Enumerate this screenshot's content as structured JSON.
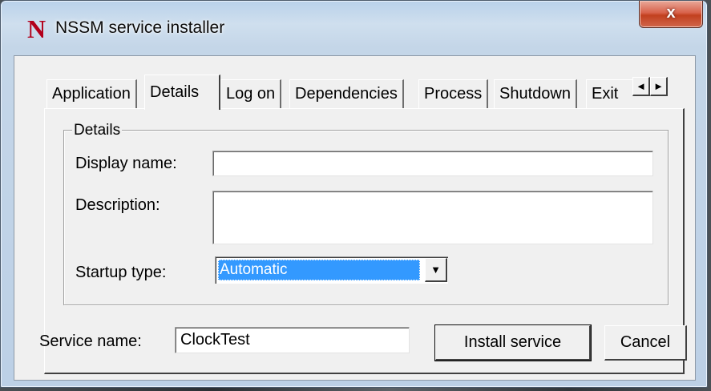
{
  "window": {
    "title": "NSSM service installer",
    "icon_letter": "N",
    "close_glyph": "x",
    "close_color": "#c7472a"
  },
  "tabs": [
    {
      "label": "Application",
      "selected": false
    },
    {
      "label": "Details",
      "selected": true
    },
    {
      "label": "Log on",
      "selected": false
    },
    {
      "label": "Dependencies",
      "selected": false
    },
    {
      "label": "Process",
      "selected": false
    },
    {
      "label": "Shutdown",
      "selected": false
    },
    {
      "label": "Exit",
      "selected": false
    }
  ],
  "tab_scroll": {
    "left_glyph": "◄",
    "right_glyph": "►"
  },
  "details": {
    "group_title": "Details",
    "display_name_label": "Display name:",
    "display_name_value": "",
    "description_label": "Description:",
    "description_value": "",
    "startup_type_label": "Startup type:",
    "startup_type_value": "Automatic",
    "dropdown_glyph": "▼"
  },
  "footer": {
    "service_name_label": "Service name:",
    "service_name_value": "ClockTest",
    "install_label": "Install service",
    "cancel_label": "Cancel"
  },
  "colors": {
    "selection": "#3399ff",
    "dialog_face": "#f0f0f0"
  }
}
